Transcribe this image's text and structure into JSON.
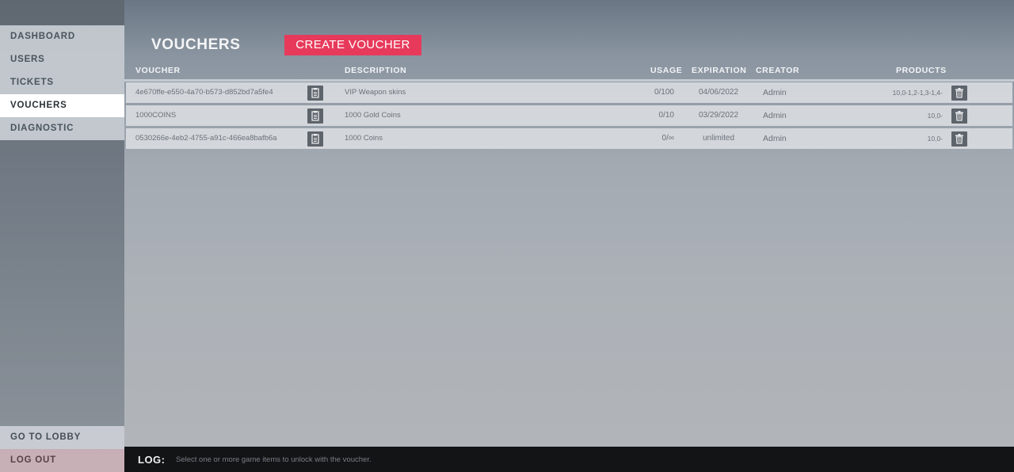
{
  "sidebar": {
    "items": [
      {
        "label": "DASHBOARD"
      },
      {
        "label": "USERS"
      },
      {
        "label": "TICKETS"
      },
      {
        "label": "VOUCHERS"
      },
      {
        "label": "DIAGNOSTIC"
      }
    ],
    "active": "VOUCHERS",
    "go_to_lobby": "GO TO LOBBY",
    "log_out": "LOG OUT"
  },
  "main": {
    "title": "VOUCHERS",
    "create_button": "CREATE VOUCHER",
    "columns": {
      "voucher": "VOUCHER",
      "description": "DESCRIPTION",
      "usage": "USAGE",
      "expiration": "EXPIRATION",
      "creator": "CREATOR",
      "products": "PRODUCTS"
    },
    "rows": [
      {
        "voucher": "4e670ffe-e550-4a70-b573-d852bd7a5fe4",
        "description": "VIP Weapon skins",
        "usage": "0/100",
        "expiration": "04/06/2022",
        "creator": "Admin",
        "products": "10,0-1,2-1,3-1,4-"
      },
      {
        "voucher": "1000COINS",
        "description": "1000 Gold Coins",
        "usage": "0/10",
        "expiration": "03/29/2022",
        "creator": "Admin",
        "products": "10,0-"
      },
      {
        "voucher": "0530266e-4eb2-4755-a91c-466ea8bafb6a",
        "description": "1000 Coins",
        "usage": "0/∞",
        "expiration": "unlimited",
        "creator": "Admin",
        "products": "10,0-"
      }
    ]
  },
  "log": {
    "label": "LOG:",
    "message": "Select one or more game items to unlock with the voucher."
  },
  "icons": {
    "copy": "clipboard-icon",
    "delete": "trash-icon"
  },
  "colors": {
    "accent": "#e73a5b",
    "icon_button": "#5e646b",
    "log_bar": "#121416"
  }
}
